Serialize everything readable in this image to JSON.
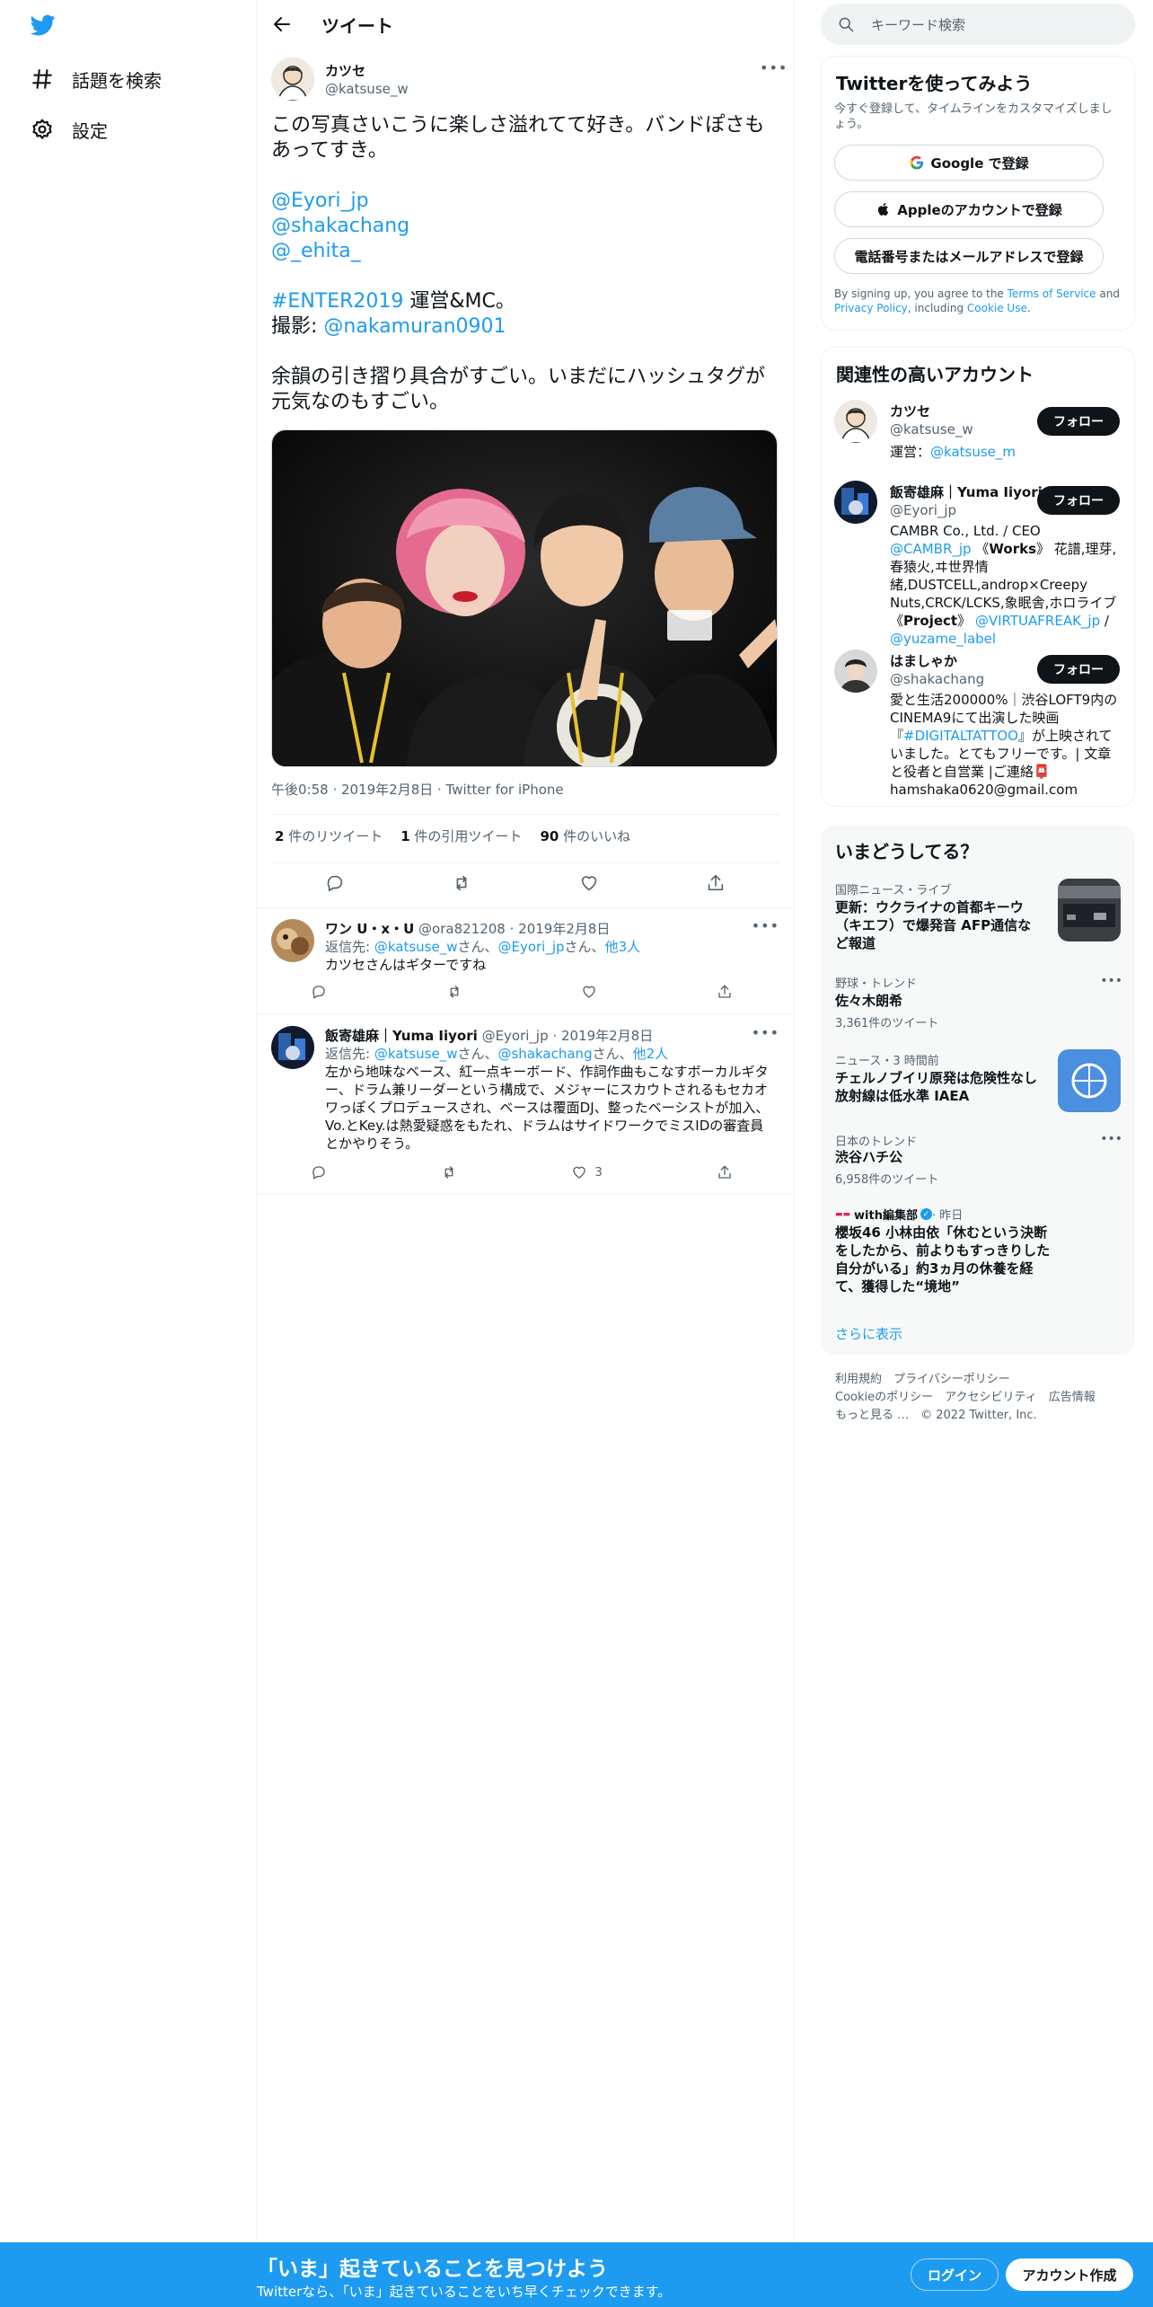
{
  "nav": {
    "explore_label": "話題を検索",
    "settings_label": "設定"
  },
  "header": {
    "title": "ツイート"
  },
  "tweet": {
    "author_name": "カツセ",
    "author_handle": "@katsuse_w",
    "text_line1": "この写真さいこうに楽しさ溢れてて好き。バンドぽさもあってすき。",
    "mention1": "@Eyori_jp",
    "mention2": "@shakachang",
    "mention3": "@_ehita_",
    "hashtag": "#ENTER2019",
    "hashtag_suffix": " 運営&MC。",
    "photo_prefix": "撮影: ",
    "photo_mention": "@nakamuran0901",
    "text_line_last": "余韻の引き摺り具合がすごい。いまだにハッシュタグが元気なのもすごい。",
    "meta": "午後0:58 · 2019年2月8日 · Twitter for iPhone",
    "retweets_count": "2",
    "retweets_label": " 件のリツイート",
    "quotes_count": "1",
    "quotes_label": " 件の引用ツイート",
    "likes_count": "90",
    "likes_label": " 件のいいね"
  },
  "replies": [
    {
      "name": "ワン U・x・U",
      "handle": "@ora821208",
      "date": "· 2019年2月8日",
      "reply_prefix": "返信先: ",
      "reply_to_1": "@katsuse_w",
      "sep1": "さん、",
      "reply_to_2": "@Eyori_jp",
      "sep2": "さん、",
      "reply_more": "他3人",
      "text": "カツセさんはギターですね",
      "like_count": ""
    },
    {
      "name": "飯寄雄麻｜Yuma Iiyori",
      "handle": "@Eyori_jp",
      "date": "· 2019年2月8日",
      "reply_prefix": "返信先: ",
      "reply_to_1": "@katsuse_w",
      "sep1": "さん、",
      "reply_to_2": "@shakachang",
      "sep2": "さん、",
      "reply_more": "他2人",
      "text": "左から地味なベース、紅一点キーボード、作詞作曲もこなすボーカルギター、ドラム兼リーダーという構成で、メジャーにスカウトされるもセカオワっぽくプロデュースされ、ベースは覆面DJ、整ったベーシストが加入、Vo.とKey.は熱愛疑惑をもたれ、ドラムはサイドワークでミスIDの審査員とかやりそう。",
      "like_count": "3"
    }
  ],
  "search": {
    "placeholder": "キーワード検索"
  },
  "signup_card": {
    "title": "Twitterを使ってみよう",
    "subtitle": "今すぐ登録して、タイムラインをカスタマイズしましょう。",
    "google_label": "Google で登録",
    "apple_label": "Appleのアカウントで登録",
    "phone_label": "電話番号またはメールアドレスで登録",
    "legal_1": "By signing up, you agree to the ",
    "legal_tos": "Terms of Service",
    "legal_2": " and ",
    "legal_pp": "Privacy Policy",
    "legal_3": ", including ",
    "legal_cookie": "Cookie Use",
    "legal_4": "."
  },
  "related": {
    "title": "関連性の高いアカウント",
    "follow_label": "フォロー",
    "accounts": [
      {
        "name": "カツセ",
        "handle": "@katsuse_w",
        "bio_prefix": "運営：",
        "bio_link": "@katsuse_m"
      },
      {
        "name": "飯寄雄麻｜Yuma Iiyori",
        "handle": "@Eyori_jp",
        "bio_a": "CAMBR Co., Ltd. / CEO ",
        "bio_link1": "@CAMBR_jp",
        "bio_b": " 《",
        "bio_bold1": "Works",
        "bio_c": "》 花譜,理芽,春猿火,ヰ世界情緒,DUSTCELL,androp×Creepy Nuts,CRCK/LCKS,象眠舎,ホロライブ 《",
        "bio_bold2": "Project",
        "bio_d": "》 ",
        "bio_link2": "@VIRTUAFREAK_jp",
        "bio_e": " / ",
        "bio_link3": "@yuzame_label"
      },
      {
        "name": "はましゃか",
        "handle": "@shakachang",
        "bio_a": "愛と生活200000%｜渋谷LOFT9内のCINEMA9にて出演した映画『",
        "bio_link": "#DIGITALTATTOO",
        "bio_b": "』が上映されていました。とてもフリーです。| 文章と役者と自営業 |ご連絡📮hamshaka0620@gmail.com"
      }
    ]
  },
  "trends": {
    "title": "いまどうしてる？",
    "items": [
      {
        "category": "国際ニュース・ライブ",
        "title": "更新：ウクライナの首都キーウ（キエフ）で爆発音 AFP通信など報道"
      },
      {
        "category": "野球・トレンド",
        "title": "佐々木朗希",
        "count": "3,361件のツイート"
      },
      {
        "category": "ニュース・3 時間前",
        "title": "チェルノブイリ原発は危険性なし 放射線は低水準 IAEA"
      },
      {
        "category": "日本のトレンド",
        "title": "渋谷ハチ公",
        "count": "6,958件のツイート"
      },
      {
        "category_source": "with編集部",
        "category_time": " · 昨日",
        "title": "櫻坂46 小林由依「休むという決断をしたから、前よりもすっきりした自分がいる」約3ヵ月の休養を経て、獲得した“境地”"
      }
    ],
    "show_more": "さらに表示"
  },
  "footer": {
    "line1": "利用規約　プライバシーポリシー",
    "line2": "Cookieのポリシー　アクセシビリティ　広告情報",
    "line3": "もっと見る …　© 2022 Twitter, Inc."
  },
  "banner": {
    "title": "「いま」起きていることを見つけよう",
    "subtitle": "Twitterなら、「いま」起きていることをいち早くチェックできます。",
    "login_label": "ログイン",
    "signup_label": "アカウント作成"
  },
  "colors": {
    "accent": "#1d9bf0",
    "text": "#0f1419",
    "muted": "#536471"
  }
}
